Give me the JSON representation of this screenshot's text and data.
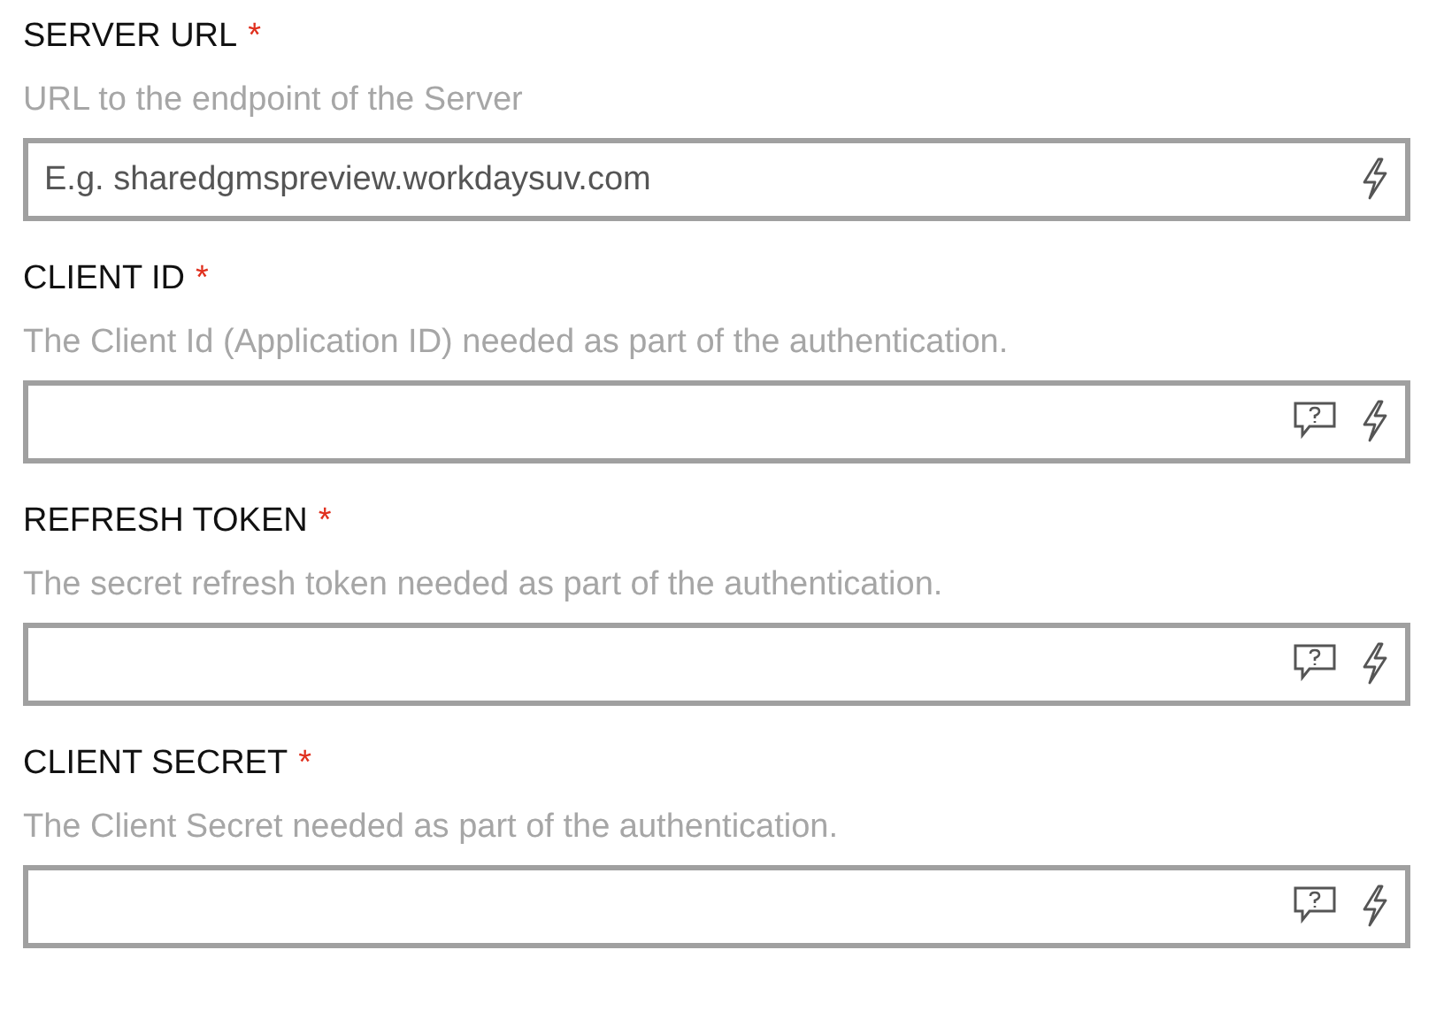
{
  "fields": [
    {
      "label": "SERVER URL",
      "required_mark": "*",
      "description": "URL to the endpoint of the Server",
      "placeholder": "E.g. sharedgmspreview.workdaysuv.com",
      "help_icon": false
    },
    {
      "label": "CLIENT ID",
      "required_mark": "*",
      "description": "The Client Id (Application ID) needed as part of the authentication.",
      "help_icon": true
    },
    {
      "label": "REFRESH TOKEN",
      "required_mark": "*",
      "description": "The secret refresh token needed as part of the authentication.",
      "help_icon": true
    },
    {
      "label": "CLIENT SECRET",
      "required_mark": "*",
      "description": "The Client Secret needed as part of the authentication.",
      "help_icon": true
    }
  ]
}
